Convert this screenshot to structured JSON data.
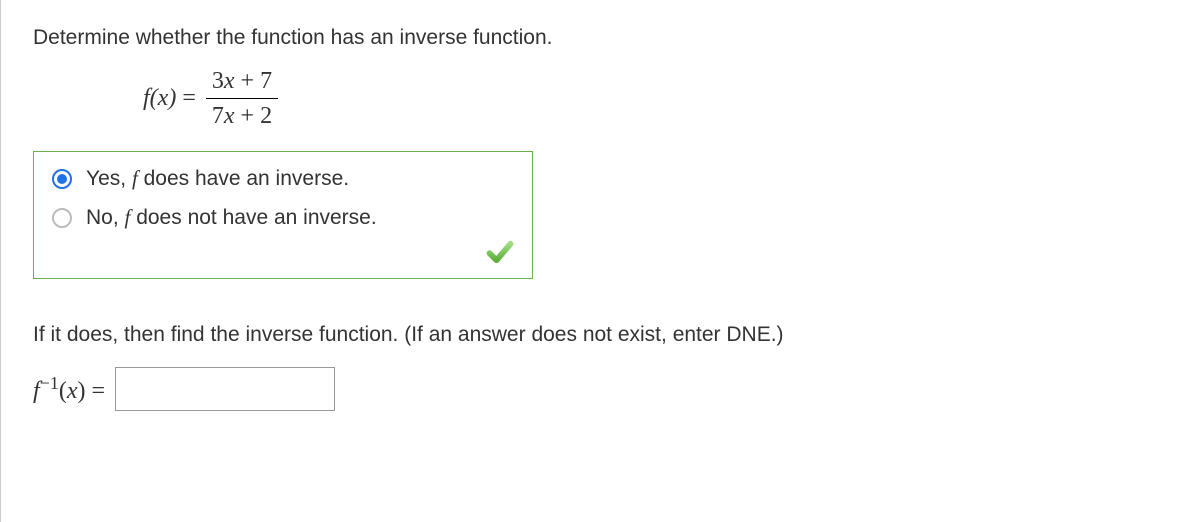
{
  "question": {
    "prompt": "Determine whether the function has an inverse function.",
    "equation": {
      "lhs_fn": "f",
      "lhs_var": "x",
      "eq": " = ",
      "numerator": "3x + 7",
      "denominator": "7x + 2"
    }
  },
  "options": {
    "yes": {
      "label": "Yes, f does have an inverse.",
      "checked": true
    },
    "no": {
      "label": "No, f does not have an inverse.",
      "checked": false
    }
  },
  "followup": {
    "prompt": "If it does, then find the inverse function. (If an answer does not exist, enter DNE.)",
    "label_prefix": "f",
    "label_sup": "−1",
    "label_var": "x",
    "label_eq": " = ",
    "input_value": ""
  },
  "icons": {
    "checkmark": "checkmark-icon"
  }
}
